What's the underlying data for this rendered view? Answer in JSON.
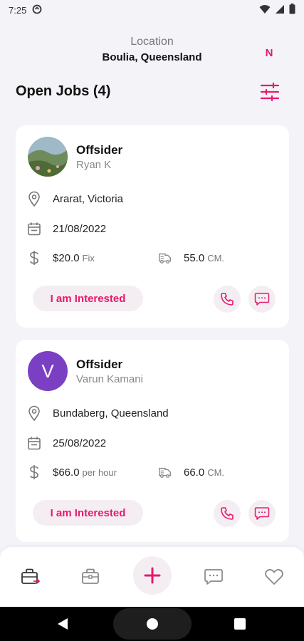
{
  "status_bar": {
    "time": "7:25"
  },
  "header": {
    "location_label": "Location",
    "location_value": "Boulia, Queensland",
    "avatar_initial": "N"
  },
  "page_title": "Open Jobs (4)",
  "jobs": [
    {
      "title": "Offsider",
      "poster_name": "Ryan K",
      "poster_avatar": "photo",
      "location": "Ararat, Victoria",
      "date": "21/08/2022",
      "pay": "$20.0",
      "pay_type": "Fix",
      "distance": "55.0",
      "distance_unit": "CM.",
      "interest_label": "I am Interested"
    },
    {
      "title": "Offsider",
      "poster_name": "Varun Kamani",
      "poster_initial": "V",
      "location": "Bundaberg, Queensland",
      "date": "25/08/2022",
      "pay": "$66.0",
      "pay_type": "per hour",
      "distance": "66.0",
      "distance_unit": "CM.",
      "interest_label": "I am Interested"
    }
  ],
  "icons": {
    "location": "map-pin-icon",
    "date": "calendar-icon",
    "pay": "dollar-icon",
    "distance": "truck-icon",
    "call": "phone-icon",
    "chat": "chat-icon",
    "filter": "sliders-icon"
  },
  "bottom_nav": [
    "jobs-icon",
    "briefcase-icon",
    "add-icon",
    "chat-icon",
    "heart-icon"
  ],
  "colors": {
    "accent": "#e8196e",
    "avatar_bg": "#7b3fc4",
    "background": "#f3f3f8",
    "chip_bg": "#f4eef2"
  }
}
